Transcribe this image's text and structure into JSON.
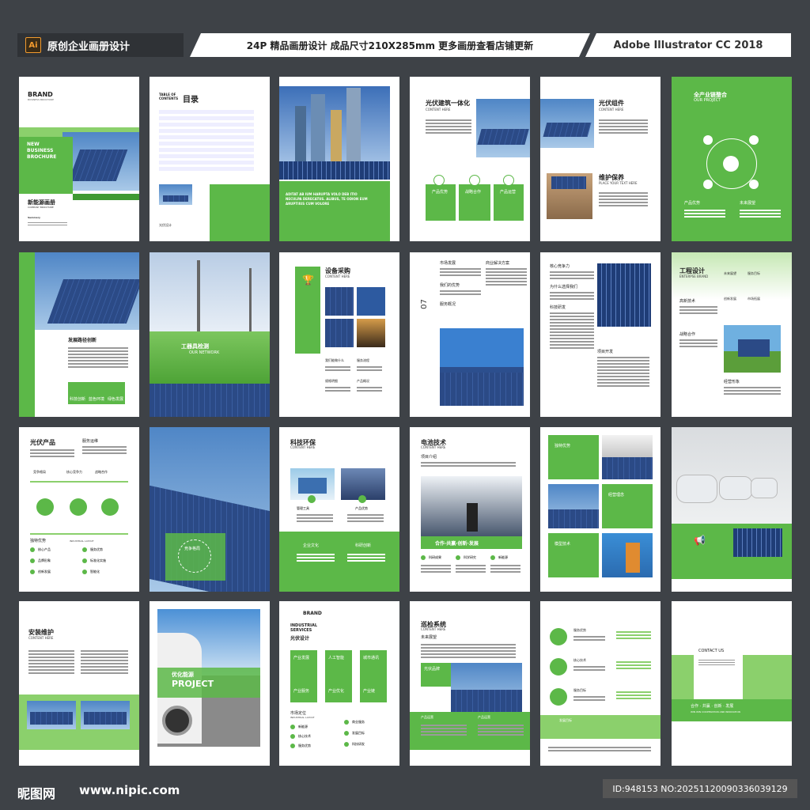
{
  "header": {
    "badge": "Ai",
    "title_left": "原创企业画册设计",
    "title_mid": "24P 精品画册设计 成品尺寸210X285mm 更多画册查看店铺更新",
    "title_right": "Adobe Illustrator CC 2018"
  },
  "pages": {
    "p1": {
      "brand": "BRAND",
      "brand_sub": "BUSINESS BROCHURE",
      "cover": "NEW BUSINESS BROCHURE",
      "cn": "新能源画册",
      "en": "COMPANY BROCHURE",
      "summary": "Summary"
    },
    "p2": {
      "toc_en": "TABLE OF CONTENTS",
      "toc_cn": "目录",
      "footer": "光伏设计"
    },
    "p3": {
      "caption": "ADITAT AB IUM HARUPTA VOLO DEB ITIO NECULPA DERECATUS. ALIBUS, TE ODION EUM ARUPTIIUS CUM VOLORE"
    },
    "p4": {
      "title": "光伏建筑一体化",
      "sub": "CONTENT HERE",
      "b1": "产品优势",
      "b2": "战略合作",
      "b3": "产品运营"
    },
    "p5": {
      "title": "光伏组件",
      "sub": "CONTENT HERE",
      "t2": "维护保养",
      "t2sub": "PLACE YOUR TEXT HERE"
    },
    "p6": {
      "title": "全产业链整合",
      "sub": "OUR PROJECT",
      "l1": "产品优势",
      "l2": "未来展望"
    },
    "p7": {
      "title": "发展路径创新",
      "i1": "科技创新",
      "i2": "蓝色环境",
      "i3": "绿色发展"
    },
    "p8": {
      "title": "工器具检测",
      "sub": "OUR NETWORK"
    },
    "p9": {
      "title": "设备采购",
      "sub": "CONTENT HERE",
      "l1": "我们能做什么",
      "l2": "服务流程",
      "l3": "规格明细",
      "l4": "产品概况"
    },
    "p10": {
      "num": "07",
      "side": "工程展示 INDUSTRIAL DESIGN",
      "l1": "市场发展",
      "l2": "商业解决方案",
      "l3": "我们的优势",
      "l4": "服务概况"
    },
    "p11": {
      "l1": "核心竞争力",
      "l2": "为什么选择我们",
      "l3": "科技研发",
      "l4": "项目开发"
    },
    "p12": {
      "title": "工程设计",
      "sub": "ENTERPSE BRAND",
      "l1": "高新技术",
      "l2": "战略合作",
      "l3": "经营形象",
      "b1": "未来展望",
      "b2": "服务目标",
      "b3": "创新发展",
      "b4": "市场拓展"
    },
    "p13": {
      "title": "光伏产品",
      "sub": "服务运维",
      "c1": "竞争格局",
      "c2": "核心竞争力",
      "c3": "战略合作",
      "l1": "独特优势",
      "l2": "INDUSTRIAL LAYOUT",
      "i1": "核心产品",
      "i2": "服务优势",
      "i3": "品牌形象",
      "i4": "标准化实施",
      "i5": "创新发展",
      "i6": "智能化"
    },
    "p14": {
      "badge": "竞争格局"
    },
    "p15": {
      "title": "科技环保",
      "sub": "CONTENT HERE",
      "l1": "管理工具",
      "l2": "产品优势",
      "b1": "企业文化",
      "b2": "科研创新"
    },
    "p16": {
      "title": "电池技术",
      "sub": "CONTENT HERE",
      "l1": "项目介绍",
      "banner": "合作·共赢·创新·发展",
      "i1": "科研成果",
      "i2": "科学研究",
      "i3": "新能源"
    },
    "p17": {
      "l1": "独特优势",
      "l2": "经营理念",
      "l3": "模型技术"
    },
    "p19": {
      "title": "安装维护",
      "sub": "CONTENT HERE"
    },
    "p20": {
      "cn": "优化能源",
      "en": "PROJECT"
    },
    "p21": {
      "brand": "BRAND",
      "title": "INDUSTRIAL SERVICES",
      "cn": "光伏设计",
      "b1": "产业发展",
      "b2": "人工智能",
      "b3": "城市通讯",
      "s1": "产业服务",
      "s2": "产业优化",
      "s3": "产业链",
      "l1": "市场定位",
      "l2": "INDUSTRIAL LAYOUT",
      "i1": "新能源",
      "i2": "核心技术",
      "i3": "服务优势",
      "i4": "商业服务",
      "i5": "发展目标",
      "i6": "科技研发"
    },
    "p22": {
      "title": "巡检系统",
      "sub": "CONTENT HERE",
      "l1": "未来展望",
      "b1": "光伏品牌",
      "l2": "产品运营",
      "l3": "产品运营"
    },
    "p23": {
      "t1": "服务优势",
      "t2": "核心技术",
      "t3": "服务目标",
      "b": "发展目标"
    },
    "p24": {
      "contact": "CONTACT US",
      "slogan": "合作 · 共赢 · 创新 · 发展",
      "sub": "WIN WIN COOPERATION AND INNOVATION"
    }
  },
  "footer": {
    "logo": "昵图网",
    "url": "www.nipic.com",
    "id": "ID:948153 NO:20251120090336039129"
  },
  "colors": {
    "green": "#5cb848",
    "light_green": "#8bd06c",
    "dark_bg": "#3e4247"
  }
}
